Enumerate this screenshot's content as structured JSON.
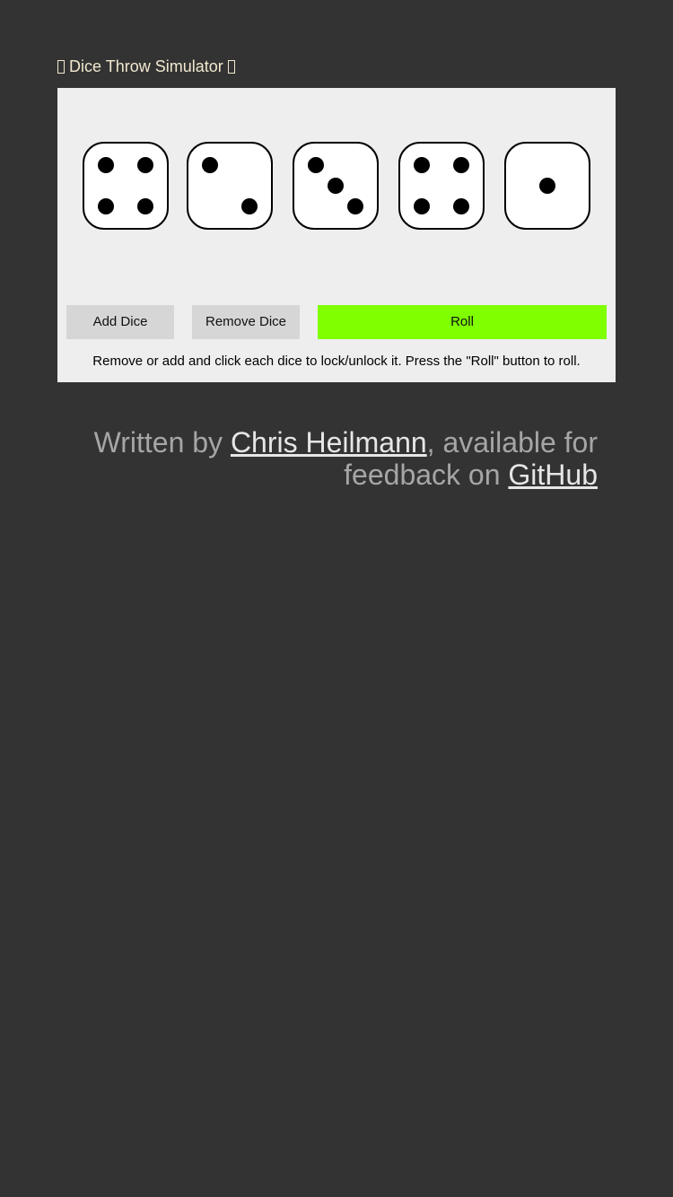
{
  "header": {
    "title": "Dice Throw Simulator"
  },
  "dice": [
    {
      "value": 4,
      "locked": false
    },
    {
      "value": 2,
      "locked": false
    },
    {
      "value": 3,
      "locked": false
    },
    {
      "value": 4,
      "locked": false
    },
    {
      "value": 1,
      "locked": false
    }
  ],
  "controls": {
    "add_label": "Add Dice",
    "remove_label": "Remove Dice",
    "roll_label": "Roll",
    "hint": "Remove or add and click each dice to lock/unlock it. Press the \"Roll\" button to roll."
  },
  "footer": {
    "prefix": "Written by ",
    "author": "Chris Heilmann",
    "middle": ", available for feedback on ",
    "repo": "GitHub"
  },
  "colors": {
    "background": "#333333",
    "panel": "#eeeeee",
    "roll_button": "#7fff00",
    "grey_button": "#d6d6d6",
    "title_text": "#f2e8d0",
    "footer_text": "#a6a6a6"
  },
  "icons": {
    "title_left": "missing-glyph-icon",
    "title_right": "missing-glyph-icon"
  }
}
